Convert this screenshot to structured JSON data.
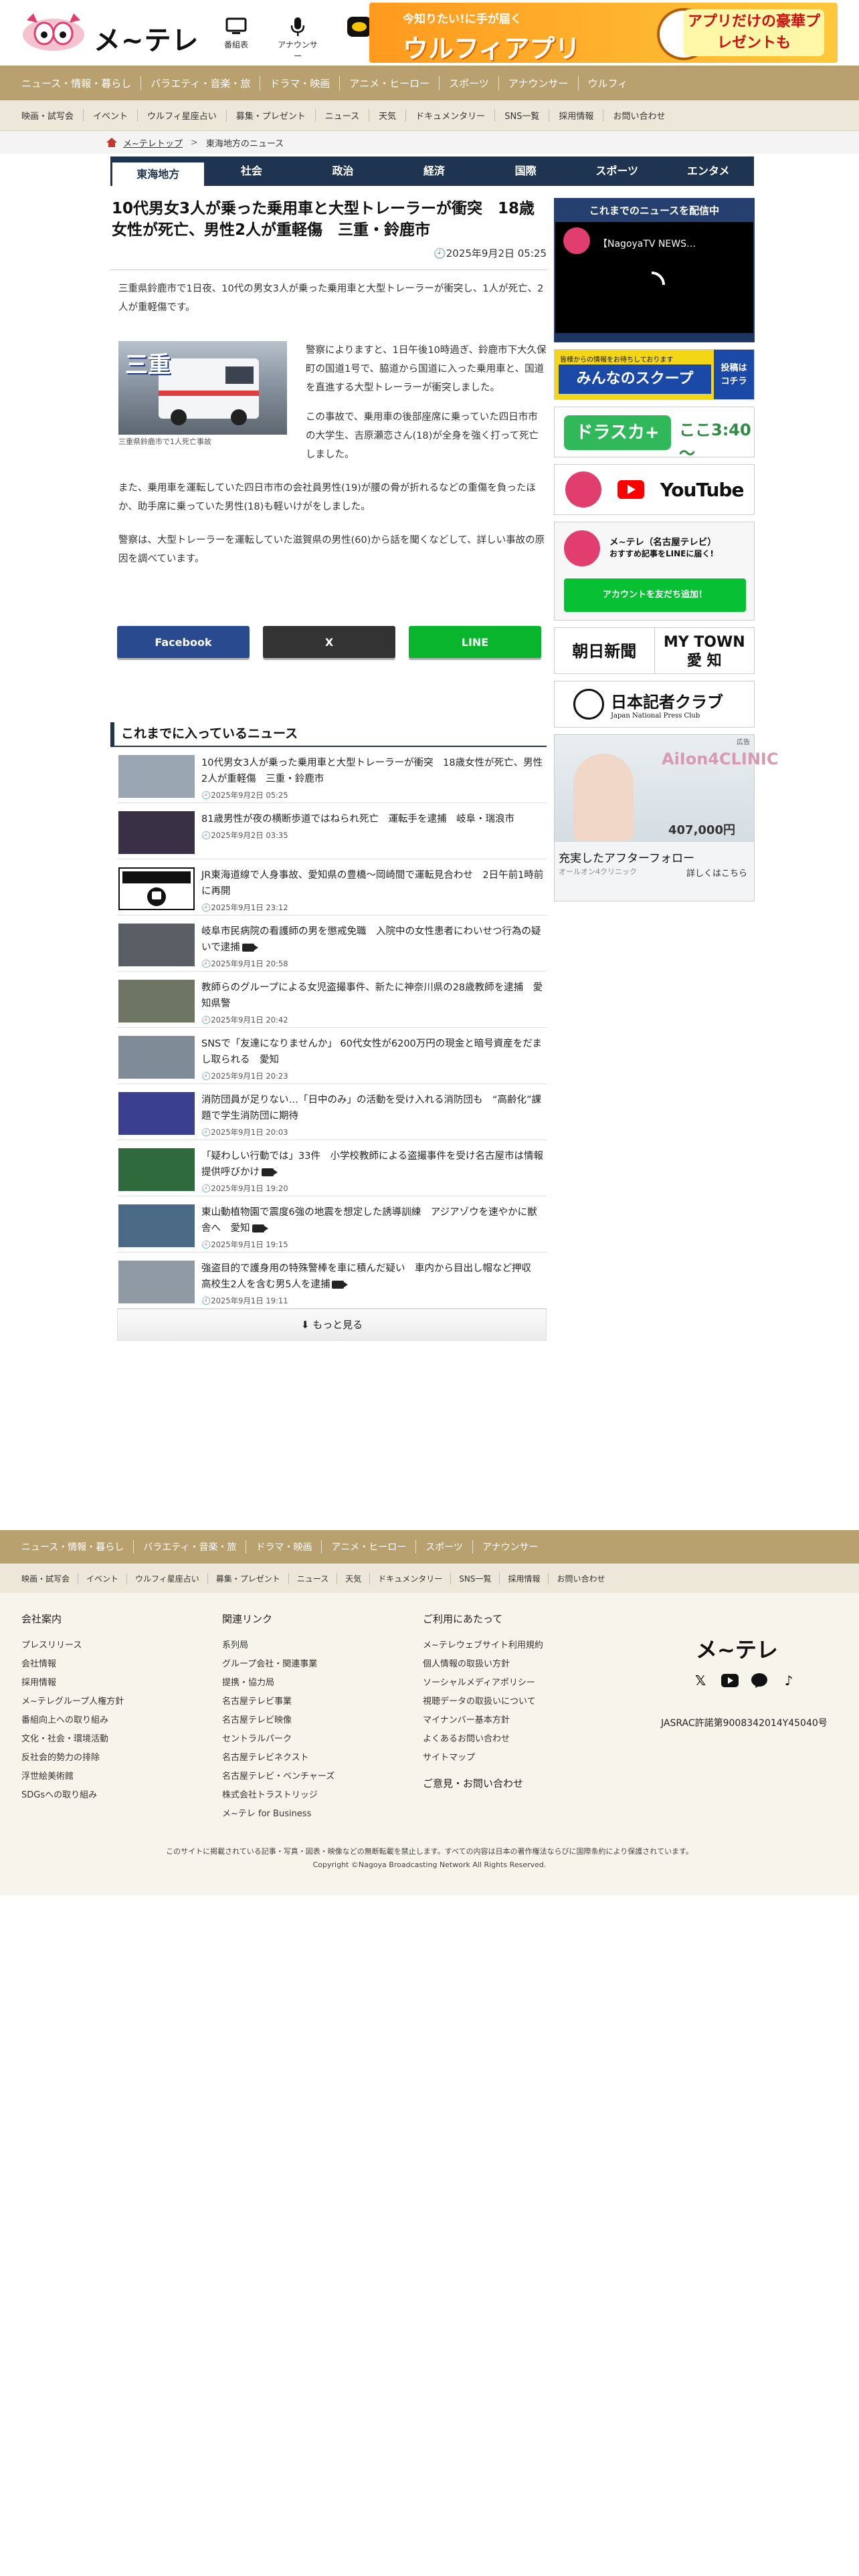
{
  "header": {
    "logo_text": "メ~テレ",
    "icons": [
      {
        "label": "番組表",
        "icon": "tv-guide-icon"
      },
      {
        "label": "アナウンサー",
        "icon": "microphone-icon"
      },
      {
        "label": "",
        "icon": "locipo-icon"
      }
    ],
    "app_banner": {
      "line1": "今知りたい!に手が届く",
      "line2": "ウルフィアプリ",
      "line3": "アプリだけの豪華プレゼントも"
    }
  },
  "nav_primary": [
    "ニュース・情報・暮らし",
    "バラエティ・音楽・旅",
    "ドラマ・映画",
    "アニメ・ヒーロー",
    "スポーツ",
    "アナウンサー",
    "ウルフィ"
  ],
  "nav_secondary": [
    "映画・試写会",
    "イベント",
    "ウルフィ星座占い",
    "募集・プレゼント",
    "ニュース",
    "天気",
    "ドキュメンタリー",
    "SNS一覧",
    "採用情報",
    "お問い合わせ"
  ],
  "breadcrumb": {
    "home": "メ~テレトップ",
    "current": "東海地方のニュース"
  },
  "category_tabs": [
    "東海地方",
    "社会",
    "政治",
    "経済",
    "国際",
    "スポーツ",
    "エンタメ"
  ],
  "article": {
    "title": "10代男女3人が乗った乗用車と大型トレーラーが衝突　18歳女性が死亡、男性2人が重軽傷　三重・鈴鹿市",
    "date": "2025年9月2日 05:25",
    "lead": "三重県鈴鹿市で1日夜、10代の男女3人が乗った乗用車と大型トレーラーが衝突し、1人が死亡、2人が重軽傷です。",
    "photo_caption": "三重県鈴鹿市で1人死亡事故",
    "photo_text": "三重",
    "p1": "警察によりますと、1日午後10時過ぎ、鈴鹿市下大久保町の国道1号で、脇道から国道に入った乗用車と、国道を直進する大型トレーラーが衝突しました。",
    "p2": "この事故で、乗用車の後部座席に乗っていた四日市市の大学生、吉原瀬恋さん(18)が全身を強く打って死亡しました。",
    "p3": "また、乗用車を運転していた四日市市の会社員男性(19)が腰の骨が折れるなどの重傷を負ったほか、助手席に乗っていた男性(18)も軽いけがをしました。",
    "p4": "警察は、大型トレーラーを運転していた滋賀県の男性(60)から話を聞くなどして、詳しい事故の原因を調べています。"
  },
  "share": {
    "facebook": "Facebook",
    "x": "X",
    "line": "LINE"
  },
  "news": {
    "heading": "これまでに入っているニュース",
    "items": [
      {
        "title": "10代男女3人が乗った乗用車と大型トレーラーが衝突　18歳女性が死亡、男性2人が重軽傷　三重・鈴鹿市",
        "date": "2025年9月2日 05:25",
        "video": false,
        "thumb": "#9aa7b3"
      },
      {
        "title": "81歳男性が夜の横断歩道ではねられ死亡　運転手を逮捕　岐阜・瑞浪市",
        "date": "2025年9月2日 03:35",
        "video": false,
        "thumb": "#3a3046"
      },
      {
        "title": "JR東海道線で人身事故、愛知県の豊橋～岡崎間で運転見合わせ　2日午前1時前に再開",
        "date": "2025年9月1日 23:12",
        "video": false,
        "thumb": "#ffffff"
      },
      {
        "title": "岐阜市民病院の看護師の男を懲戒免職　入院中の女性患者にわいせつ行為の疑いで逮捕",
        "date": "2025年9月1日 20:58",
        "video": true,
        "thumb": "#5a5f66"
      },
      {
        "title": "教師らのグループによる女児盗撮事件、新たに神奈川県の28歳教師を逮捕　愛知県警",
        "date": "2025年9月1日 20:42",
        "video": false,
        "thumb": "#6e7563"
      },
      {
        "title": "SNSで「友達になりませんか」 60代女性が6200万円の現金と暗号資産をだまし取られる　愛知",
        "date": "2025年9月1日 20:23",
        "video": false,
        "thumb": "#7f8b96"
      },
      {
        "title": "消防団員が足りない…「日中のみ」の活動を受け入れる消防団も　“高齢化”課題で学生消防団に期待",
        "date": "2025年9月1日 20:03",
        "video": false,
        "thumb": "#3b3f8f"
      },
      {
        "title": "「疑わしい行動では」33件　小学校教師による盗撮事件を受け名古屋市は情報提供呼びかけ",
        "date": "2025年9月1日 19:20",
        "video": true,
        "thumb": "#2f6a3d"
      },
      {
        "title": "東山動植物園で震度6強の地震を想定した誘導訓練　アジアゾウを速やかに獣舎へ　愛知",
        "date": "2025年9月1日 19:15",
        "video": true,
        "thumb": "#4a6a86"
      },
      {
        "title": "強盗目的で護身用の特殊警棒を車に積んだ疑い　車内から目出し帽など押収　高校生2人を含む男5人を逮捕",
        "date": "2025年9月1日 19:11",
        "video": true,
        "thumb": "#8f9aa5"
      }
    ],
    "more": "もっと見る"
  },
  "sidebar": {
    "video_heading": "これまでのニュースを配信中",
    "video_title": "【NagoyaTV NEWS…",
    "scoop_small": "皆様からの情報をお待ちしております",
    "scoop_main": "みんなのスクープ",
    "scoop_right": "投稿は\nコチラ",
    "dorasuka": "ドラスカ+",
    "dorasuka_time": "ここ3:40～",
    "youtube_text": "YouTube",
    "line_title": "メ~テレ（名古屋テレビ）",
    "line_sub": "おすすめ記事をLINEに届く!",
    "line_button": "アカウントを友だち追加！",
    "asahi": "朝日新聞",
    "mytown": "MY TOWN\n愛 知",
    "pressclub": "日本記者クラブ",
    "pressclub_en": "Japan National Press Club",
    "ad_label": "広告",
    "ad_brand": "AiIon4CLINIC",
    "ad_price": "407,000円",
    "ad_title": "充実したアフターフォロー",
    "ad_sub": "オールオン4クリニック",
    "ad_link": "詳しくはこちら"
  },
  "footer": {
    "nav_primary": [
      "ニュース・情報・暮らし",
      "バラエティ・音楽・旅",
      "ドラマ・映画",
      "アニメ・ヒーロー",
      "スポーツ",
      "アナウンサー"
    ],
    "nav_secondary": [
      "映画・試写会",
      "イベント",
      "ウルフィ星座占い",
      "募集・プレゼント",
      "ニュース",
      "天気",
      "ドキュメンタリー",
      "SNS一覧",
      "採用情報",
      "お問い合わせ"
    ],
    "col1_title": "会社案内",
    "col1": [
      "プレスリリース",
      "会社情報",
      "採用情報",
      "メ~テレグループ人権方針",
      "番組向上への取り組み",
      "文化・社会・環境活動",
      "反社会的勢力の排除",
      "浮世絵美術館",
      "SDGsへの取り組み"
    ],
    "col2_title": "関連リンク",
    "col2": [
      "系列局",
      "グループ会社・関連事業",
      "提携・協力局",
      "名古屋テレビ事業",
      "名古屋テレビ映像",
      "セントラルパーク",
      "名古屋テレビネクスト",
      "名古屋テレビ・ベンチャーズ",
      "株式会社トラストリッジ",
      "メ~テレ for Business"
    ],
    "col3_title": "ご利用にあたって",
    "col3": [
      "メ~テレウェブサイト利用規約",
      "個人情報の取扱い方針",
      "ソーシャルメディアポリシー",
      "視聴データの取扱いについて",
      "マイナンバー基本方針",
      "よくあるお問い合わせ",
      "サイトマップ"
    ],
    "contact": "ご意見・お問い合わせ",
    "logo": "メ~テレ",
    "jasrac": "JASRAC許諾第9008342014Y45040号",
    "copy1": "このサイトに掲載されている記事・写真・図表・映像などの無断転載を禁止します。すべての内容は日本の著作権法ならびに国際条約により保護されています。",
    "copy2": "Copyright ©Nagoya Broadcasting Network All Rights Reserved."
  }
}
